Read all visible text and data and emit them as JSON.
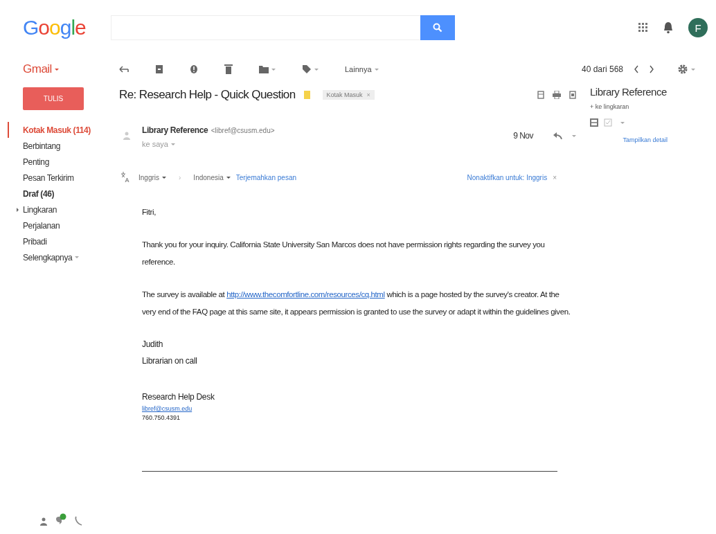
{
  "logo": "Google",
  "header": {
    "avatar_letter": "F"
  },
  "app_menu": {
    "label": "Gmail"
  },
  "toolbar": {
    "more_label": "Lainnya",
    "pagination": "40 dari 568"
  },
  "compose": {
    "label": "TULIS"
  },
  "sidebar": {
    "items": [
      {
        "label": "Kotak Masuk (114)",
        "selected": true,
        "bold": false
      },
      {
        "label": "Berbintang",
        "selected": false,
        "bold": false
      },
      {
        "label": "Penting",
        "selected": false,
        "bold": false
      },
      {
        "label": "Pesan Terkirim",
        "selected": false,
        "bold": false
      },
      {
        "label": "Draf (46)",
        "selected": false,
        "bold": true
      },
      {
        "label": "Lingkaran",
        "selected": false,
        "bold": false,
        "expanded": false
      },
      {
        "label": "Perjalanan",
        "selected": false,
        "bold": false
      },
      {
        "label": "Pribadi",
        "selected": false,
        "bold": false
      },
      {
        "label": "Selengkapnya",
        "selected": false,
        "bold": false,
        "dropdown": true
      }
    ]
  },
  "message": {
    "subject": "Re: Research Help - Quick Question",
    "label_chip": "Kotak Masuk",
    "chip_close": "×",
    "sender_name": "Library Reference",
    "sender_email": "<libref@csusm.edu>",
    "recipient": "ke saya",
    "date": "9 Nov",
    "translate": {
      "from": "Inggris",
      "arrow": "›",
      "to": "Indonesia",
      "action": "Terjemahkan pesan",
      "disable": "Nonaktifkan untuk: Inggris",
      "close": "×"
    },
    "body": [
      {
        "kind": "text",
        "text": "Fitri,"
      },
      {
        "kind": "text",
        "text": "Thank you for your inquiry. California State University San Marcos does not have permission rights regarding the survey you reference."
      },
      {
        "kind": "link_text",
        "before": "The survey is available at ",
        "link": "http://www.thecomfortline.com/resources/cq.html",
        "after": " which is a page hosted by the survey's creator. At the very end of the FAQ page at this same site, it appears permission is granted to use the survey or adapt it within the guidelines given."
      }
    ],
    "signature": [
      {
        "kind": "line",
        "text": "Judith"
      },
      {
        "kind": "line",
        "text": "Librarian on call"
      },
      {
        "kind": "gap"
      },
      {
        "kind": "line",
        "text": "Research Help Desk"
      },
      {
        "kind": "link",
        "text": "libref@csusm.edu"
      },
      {
        "kind": "small",
        "text": "760.750.4391"
      }
    ]
  },
  "contact_panel": {
    "name": "Library Reference",
    "add_link": "+ ke lingkaran",
    "details_link": "Tampilkan detail"
  }
}
